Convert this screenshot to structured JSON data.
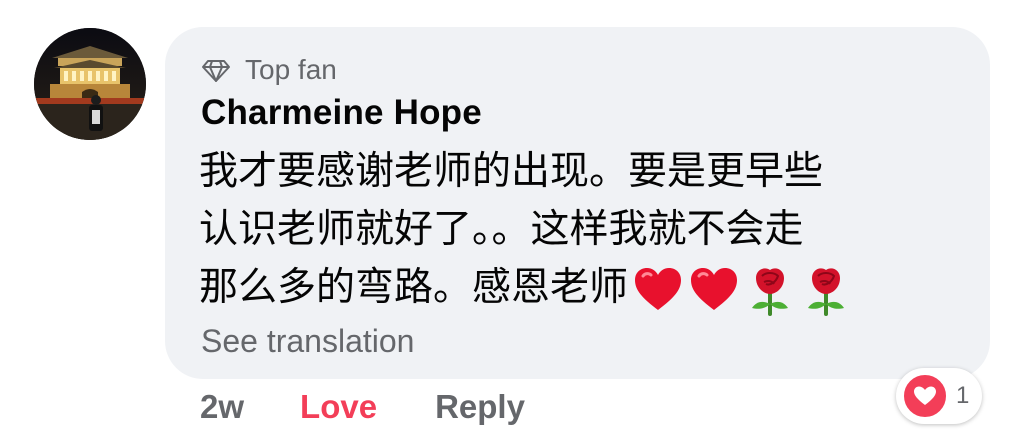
{
  "comment": {
    "badge": "Top fan",
    "badge_icon": "diamond-icon",
    "author": "Charmeine Hope",
    "text_lines": [
      "我才要感谢老师的出现。要是更早些",
      "认识老师就好了。。这样我就不会走",
      "那么多的弯路。感恩老师"
    ],
    "trailing_emoji": [
      "red-heart-icon",
      "red-heart-icon",
      "rose-icon",
      "rose-icon"
    ],
    "see_translation": "See translation"
  },
  "actions": {
    "time": "2w",
    "love": "Love",
    "reply": "Reply"
  },
  "reactions": {
    "icon": "heart-reaction-icon",
    "count": "1"
  },
  "colors": {
    "bubble": "#f0f2f5",
    "love_accent": "#f33e58",
    "secondary_text": "#65676b",
    "primary_text": "#050505"
  }
}
